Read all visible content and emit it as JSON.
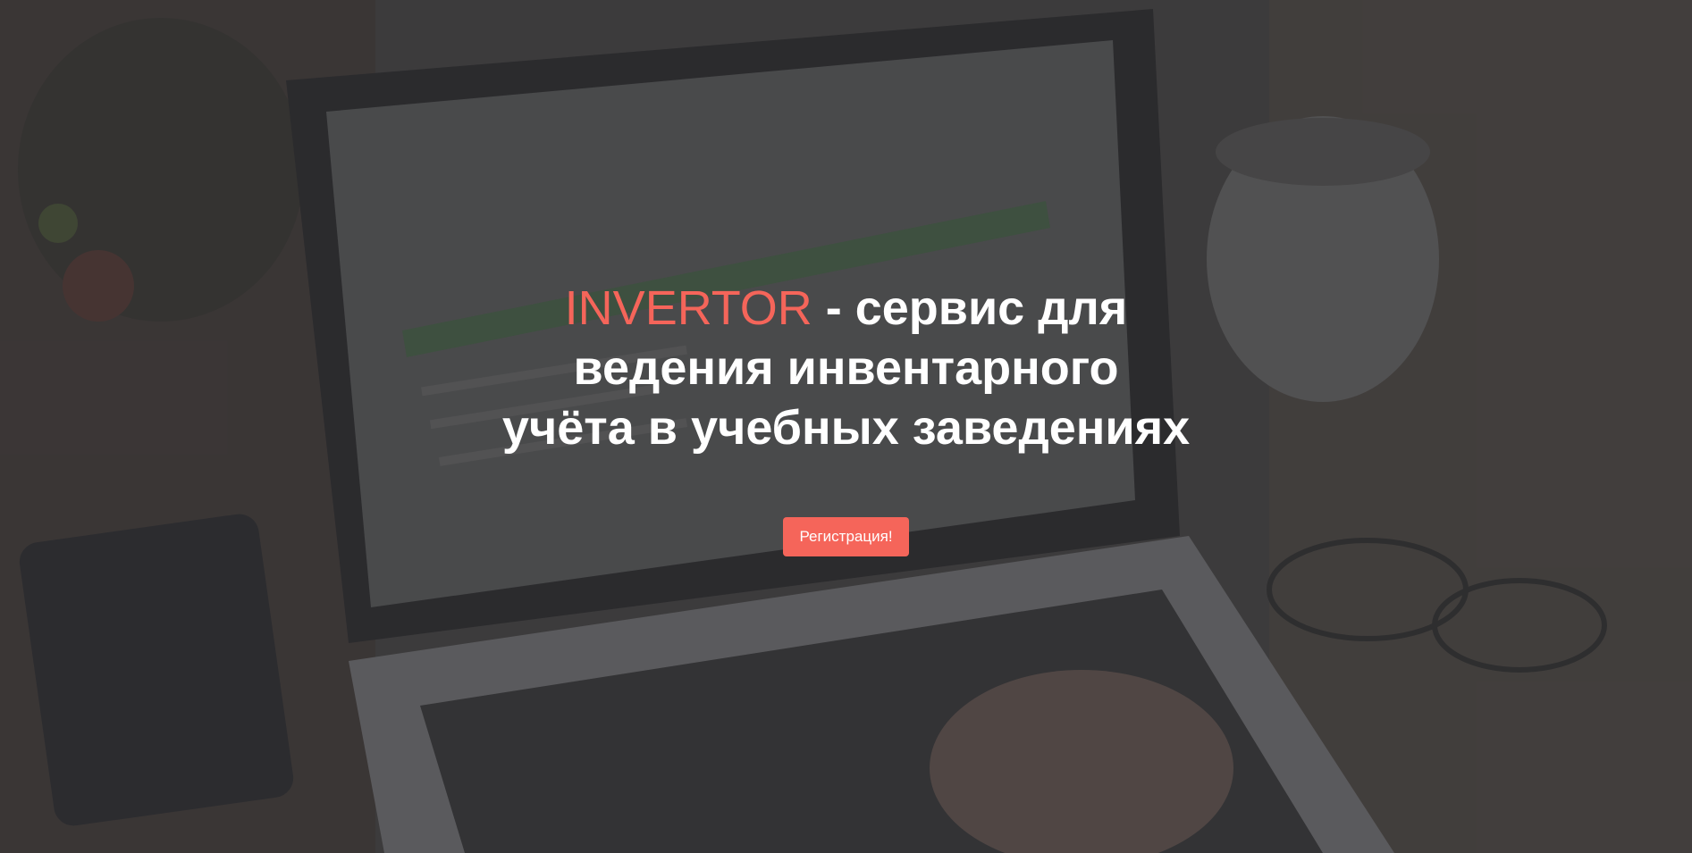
{
  "hero": {
    "brand": "INVERTOR",
    "title_line1_rest": " - сервис для",
    "title_line2": "ведения инвентарного",
    "title_line3": "учёта в учебных заведениях",
    "cta_label": "Регистрация!"
  },
  "colors": {
    "accent": "#f5655a",
    "text": "#ffffff",
    "overlay": "#3f3f40"
  }
}
